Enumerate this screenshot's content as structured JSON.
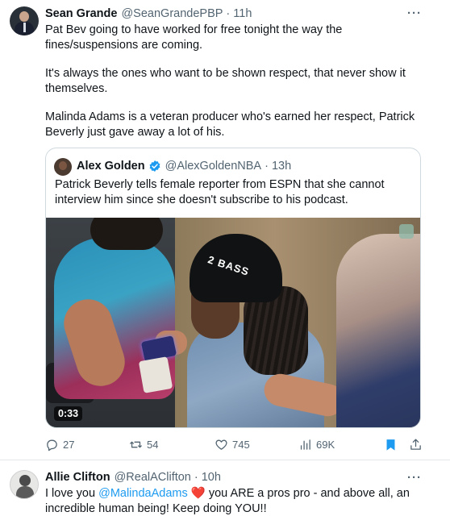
{
  "tweet": {
    "author_name": "Sean Grande",
    "author_handle": "@SeanGrandePBP",
    "separator": "·",
    "time": "11h",
    "more": "···",
    "paragraphs": [
      "Pat Bev going to have worked for free tonight the way the fines/suspensions are coming.",
      "It's always the ones who want to be shown respect, that never show it themselves.",
      "Malinda Adams is a veteran producer who's earned her respect, Patrick Beverly just gave away a lot of his."
    ],
    "quote": {
      "author_name": "Alex Golden",
      "author_handle": "@AlexGoldenNBA",
      "separator": "·",
      "time": "13h",
      "text": "Patrick Beverly tells female reporter from ESPN that she cannot interview him since she doesn't subscribe to his podcast.",
      "video_duration": "0:33",
      "beanie_text": "2 BASS"
    },
    "actions": {
      "replies": "27",
      "retweets": "54",
      "likes": "745",
      "views": "69K"
    }
  },
  "reply": {
    "author_name": "Allie Clifton",
    "author_handle": "@RealAClifton",
    "separator": "·",
    "time": "10h",
    "more": "···",
    "text_before": "I love you ",
    "mention": "@MalindaAdams",
    "heart": "❤️",
    "text_after": " you ARE a pros pro - and above all, an incredible human being! Keep doing YOU!!"
  },
  "colors": {
    "accent": "#1d9bf0",
    "secondary_text": "#536471",
    "heart": "#e0245e"
  }
}
